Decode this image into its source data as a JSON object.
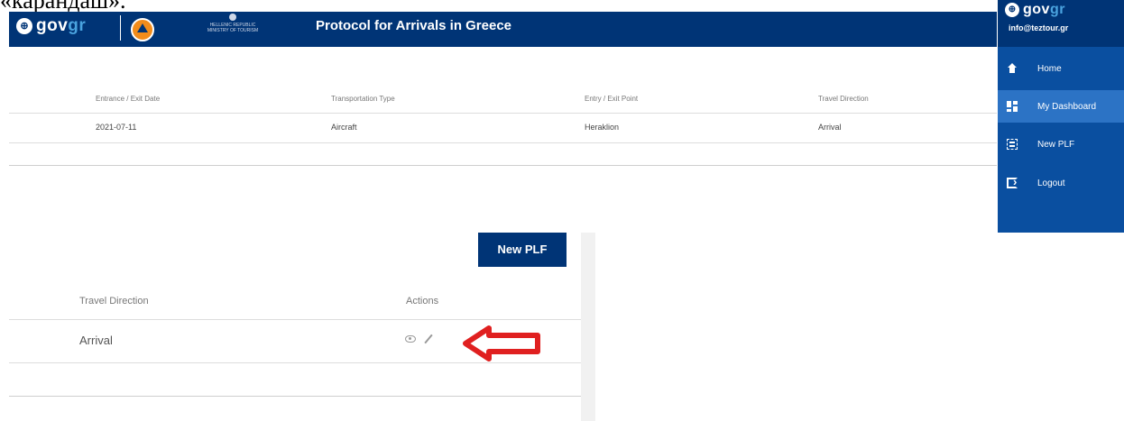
{
  "caption": "«карандаш».",
  "header": {
    "brand_gov": "gov",
    "brand_gr": "gr",
    "ministry_text": "HELLENIC REPUBLIC MINISTRY OF TOURISM",
    "title": "Protocol for Arrivals in Greece"
  },
  "side_menu": {
    "brand_gov": "gov",
    "brand_gr": "gr",
    "email": "info@teztour.gr",
    "items": [
      {
        "label": "Home",
        "icon": "home-icon"
      },
      {
        "label": "My Dashboard",
        "icon": "dashboard-icon"
      },
      {
        "label": "New PLF",
        "icon": "new-plf-icon"
      },
      {
        "label": "Logout",
        "icon": "logout-icon"
      }
    ]
  },
  "top_table": {
    "columns": [
      "Entrance / Exit Date",
      "Transportation Type",
      "Entry / Exit Point",
      "Travel Direction"
    ],
    "rows": [
      [
        "2021-07-11",
        "Aircraft",
        "Heraklion",
        "Arrival"
      ]
    ]
  },
  "bottom": {
    "new_plf_label": "New PLF",
    "columns": [
      "Travel Direction",
      "Actions"
    ],
    "row": {
      "direction": "Arrival"
    }
  },
  "colors": {
    "header_bg": "#003476",
    "side_bg": "#0a4fa0",
    "side_active": "#2c73c5",
    "arrow": "#e02020"
  }
}
